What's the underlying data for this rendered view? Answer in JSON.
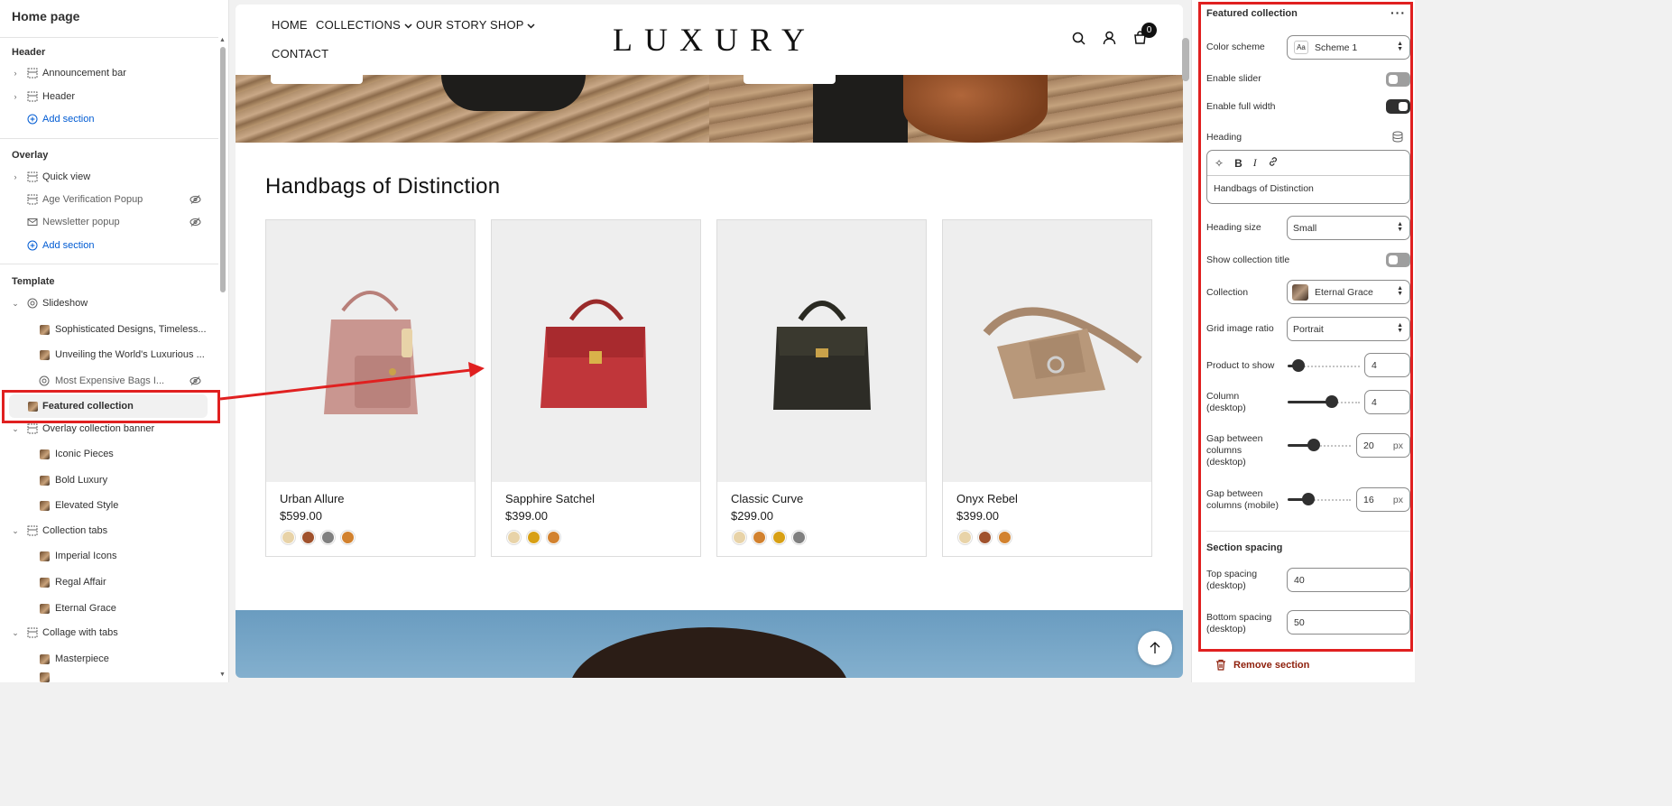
{
  "left_panel": {
    "title": "Home page",
    "groups": {
      "header": {
        "title": "Header",
        "items": [
          "Announcement bar",
          "Header"
        ],
        "add_label": "Add section"
      },
      "overlay": {
        "title": "Overlay",
        "items": [
          "Quick view",
          "Age Verification Popup",
          "Newsletter popup"
        ],
        "add_label": "Add section"
      },
      "template": {
        "title": "Template",
        "items": [
          "Slideshow",
          "Sophisticated Designs, Timeless...",
          "Unveiling the World's Luxurious ...",
          "Most Expensive Bags I...",
          "Featured collection",
          "Overlay collection banner",
          "Iconic Pieces",
          "Bold Luxury",
          "Elevated Style",
          "Collection tabs",
          "Imperial Icons",
          "Regal Affair",
          "Eternal Grace",
          "Collage with tabs",
          "Masterpiece"
        ]
      }
    }
  },
  "preview": {
    "nav": {
      "items": [
        "HOME",
        "COLLECTIONS",
        "OUR STORY",
        "SHOP",
        "CONTACT"
      ],
      "logo": "LUXURY",
      "cart_count": "0"
    },
    "section_heading": "Handbags of Distinction",
    "products": [
      {
        "name": "Urban Allure",
        "price": "$599.00",
        "swatches": [
          "#e8d3a8",
          "#a0522d",
          "#808080",
          "#d2822f"
        ]
      },
      {
        "name": "Sapphire Satchel",
        "price": "$399.00",
        "swatches": [
          "#e8d3a8",
          "#d8a015",
          "#d2822f"
        ]
      },
      {
        "name": "Classic Curve",
        "price": "$299.00",
        "swatches": [
          "#e8d3a8",
          "#d2822f",
          "#d8a015",
          "#808080"
        ]
      },
      {
        "name": "Onyx Rebel",
        "price": "$399.00",
        "swatches": [
          "#e8d3a8",
          "#a0522d",
          "#d2822f"
        ]
      }
    ]
  },
  "settings": {
    "title": "Featured collection",
    "color_scheme": {
      "label": "Color scheme",
      "value": "Scheme 1"
    },
    "enable_slider": {
      "label": "Enable slider",
      "on": false
    },
    "enable_full_width": {
      "label": "Enable full width",
      "on": true
    },
    "heading": {
      "label": "Heading",
      "value": "Handbags of Distinction"
    },
    "heading_size": {
      "label": "Heading size",
      "value": "Small"
    },
    "show_collection_title": {
      "label": "Show collection title",
      "on": false
    },
    "collection": {
      "label": "Collection",
      "value": "Eternal Grace"
    },
    "grid_image_ratio": {
      "label": "Grid image ratio",
      "value": "Portrait"
    },
    "product_to_show": {
      "label": "Product to show",
      "value": "4"
    },
    "column_desktop": {
      "label": "Column\n(desktop)",
      "value": "4"
    },
    "gap_desktop": {
      "label": "Gap between\ncolumns\n(desktop)",
      "value": "20",
      "unit": "px"
    },
    "gap_mobile": {
      "label": "Gap between\ncolumns (mobile)",
      "value": "16",
      "unit": "px"
    },
    "section_spacing": "Section spacing",
    "top_spacing": {
      "label": "Top spacing\n(desktop)",
      "value": "40"
    },
    "bottom_spacing": {
      "label": "Bottom spacing\n(desktop)",
      "value": "50"
    },
    "remove_label": "Remove section"
  },
  "colors": {
    "accent": "#005bd3",
    "annotation": "#e02020",
    "danger": "#8e1f0b"
  }
}
